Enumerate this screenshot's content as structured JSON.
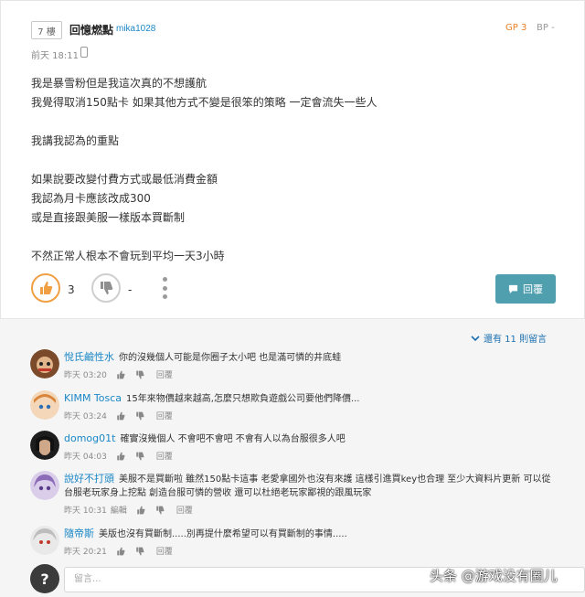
{
  "post": {
    "floor": "7 樓",
    "author_name": "回憶燃點",
    "author_id": "mika1028",
    "gp": "GP 3",
    "bp": "BP -",
    "time": "前天 18:11",
    "body_lines": [
      "我是暴雪粉但是我這次真的不想護航",
      "我覺得取消150點卡 如果其他方式不變是很笨的策略 一定會流失一些人",
      "",
      "我講我認為的重點",
      "",
      "如果說要改變付費方式或最低消費金額",
      "我認為月卡應該改成300",
      "或是直接跟美服一樣版本買斷制",
      "",
      "不然正常人根本不會玩到平均一天3小時"
    ],
    "like_count": "3",
    "dislike_count": "-",
    "reply_button": "回覆"
  },
  "comments_section": {
    "more_label": "還有 11 則留言",
    "reply_label": "回覆",
    "placeholder": "留言...",
    "items": [
      {
        "name": "悅氏鹼性水",
        "text": "你的沒幾個人可能是你圈子太小吧 也是滿可憐的井底蛙",
        "time": "昨天 03:20",
        "avatar_color": "#7a4a2a"
      },
      {
        "name": "KIMM Tosca",
        "text": "15年來物價越來越高,怎麼只想欺負遊戲公司要他們降價...",
        "time": "昨天 03:24",
        "avatar_color": "#e8b48a"
      },
      {
        "name": "domog01t",
        "text": "確實沒幾個人 不會吧不會吧 不會有人以為台服很多人吧",
        "time": "昨天 04:03",
        "avatar_color": "#1d1d1d"
      },
      {
        "name": "說好不打頭",
        "text": "美服不是買斷啦 雖然150點卡這事 老愛拿國外也沒有來護 這樣引進買key也合理 至少大資料片更新 可以從台服老玩家身上挖點 創造台服可憐的營收 還可以杜絕老玩家鄙視的跟風玩家",
        "time": "昨天 10:31",
        "time_extra": "編輯",
        "avatar_color": "#b9a3d6"
      },
      {
        "name": "隨帝斯",
        "text": "美版也沒有買斷制.....別再提什麼希望可以有買斷制的事情.....",
        "time": "昨天 20:21",
        "avatar_color": "#c9c9c9"
      }
    ]
  },
  "watermark": "头条 @游戏没有圈儿",
  "colors": {
    "accent_blue": "#1a87c6",
    "reply_button_bg": "#4f9fae",
    "gp_orange": "#e8822a",
    "like_ring": "#f0a043"
  }
}
